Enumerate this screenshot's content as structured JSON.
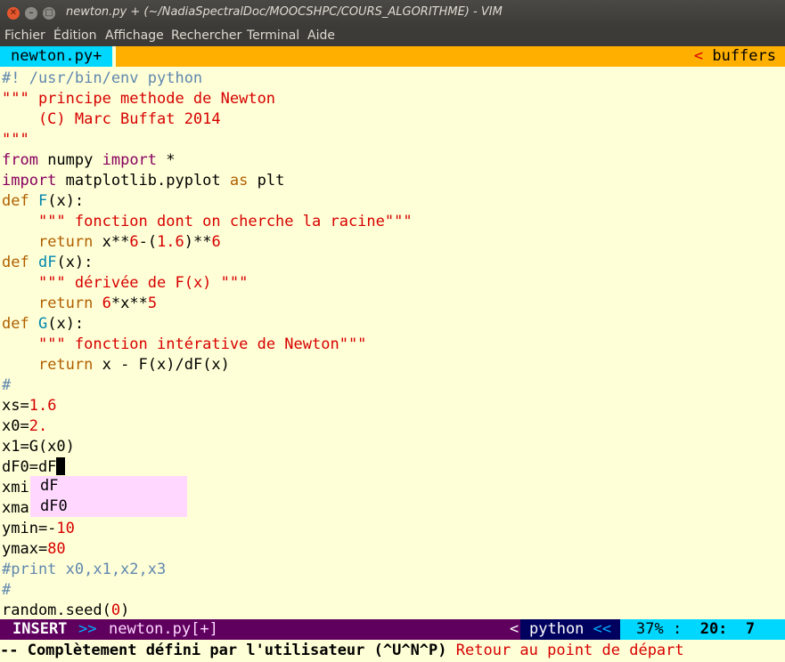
{
  "window": {
    "title": "newton.py + (~/NadiaSpectralDoc/MOOCSHPC/COURS_ALGORITHME) - VIM",
    "close_glyph": "✕",
    "min_glyph": "–",
    "max_glyph": "□"
  },
  "menu": [
    "Fichier",
    "Édition",
    "Affichage",
    "Rechercher",
    "Terminal",
    "Aide"
  ],
  "tabline": {
    "active_tab": "newton.py+",
    "right_arrow": "<",
    "right_label": "buffers"
  },
  "code_lines": [
    "#! /usr/bin/env python",
    "\"\"\" principe methode de Newton",
    "    (C) Marc Buffat 2014",
    "\"\"\"",
    "from numpy import *",
    "import matplotlib.pyplot as plt",
    "def F(x):",
    "    \"\"\" fonction dont on cherche la racine\"\"\"",
    "    return x**6-(1.6)**6",
    "def dF(x):",
    "    \"\"\" dérivée de F(x) \"\"\"",
    "    return 6*x**5",
    "def G(x):",
    "    \"\"\" fonction intérative de Newton\"\"\"",
    "    return x - F(x)/dF(x)",
    "#",
    "xs=1.6",
    "x0=2.",
    "x1=G(x0)",
    "dF0=dF",
    "xmi",
    "xma",
    "ymin=-10",
    "ymax=80",
    "#print x0,x1,x2,x3",
    "#",
    "random.seed(0)"
  ],
  "completion_popup": [
    "dF",
    "dF0"
  ],
  "statusline": {
    "mode": "INSERT",
    "sep1": ">>",
    "filename": "newton.py[+]",
    "sep2": "<",
    "filetype": "python",
    "sep3": "<<",
    "percent": "37%",
    "colon": ":",
    "line": "20:",
    "col": "7"
  },
  "message": {
    "bold_part": "-- Complètement défini par l'utilisateur (^U^N^P)",
    "red_part": "Retour au point de départ"
  },
  "colors": {
    "background": "#ffffd7",
    "keyword": "#af5f00",
    "string": "#d70000",
    "function": "#0087af",
    "comment": "#5f87af",
    "statusline": "#5f005f",
    "popup": "#ffd7ff"
  }
}
